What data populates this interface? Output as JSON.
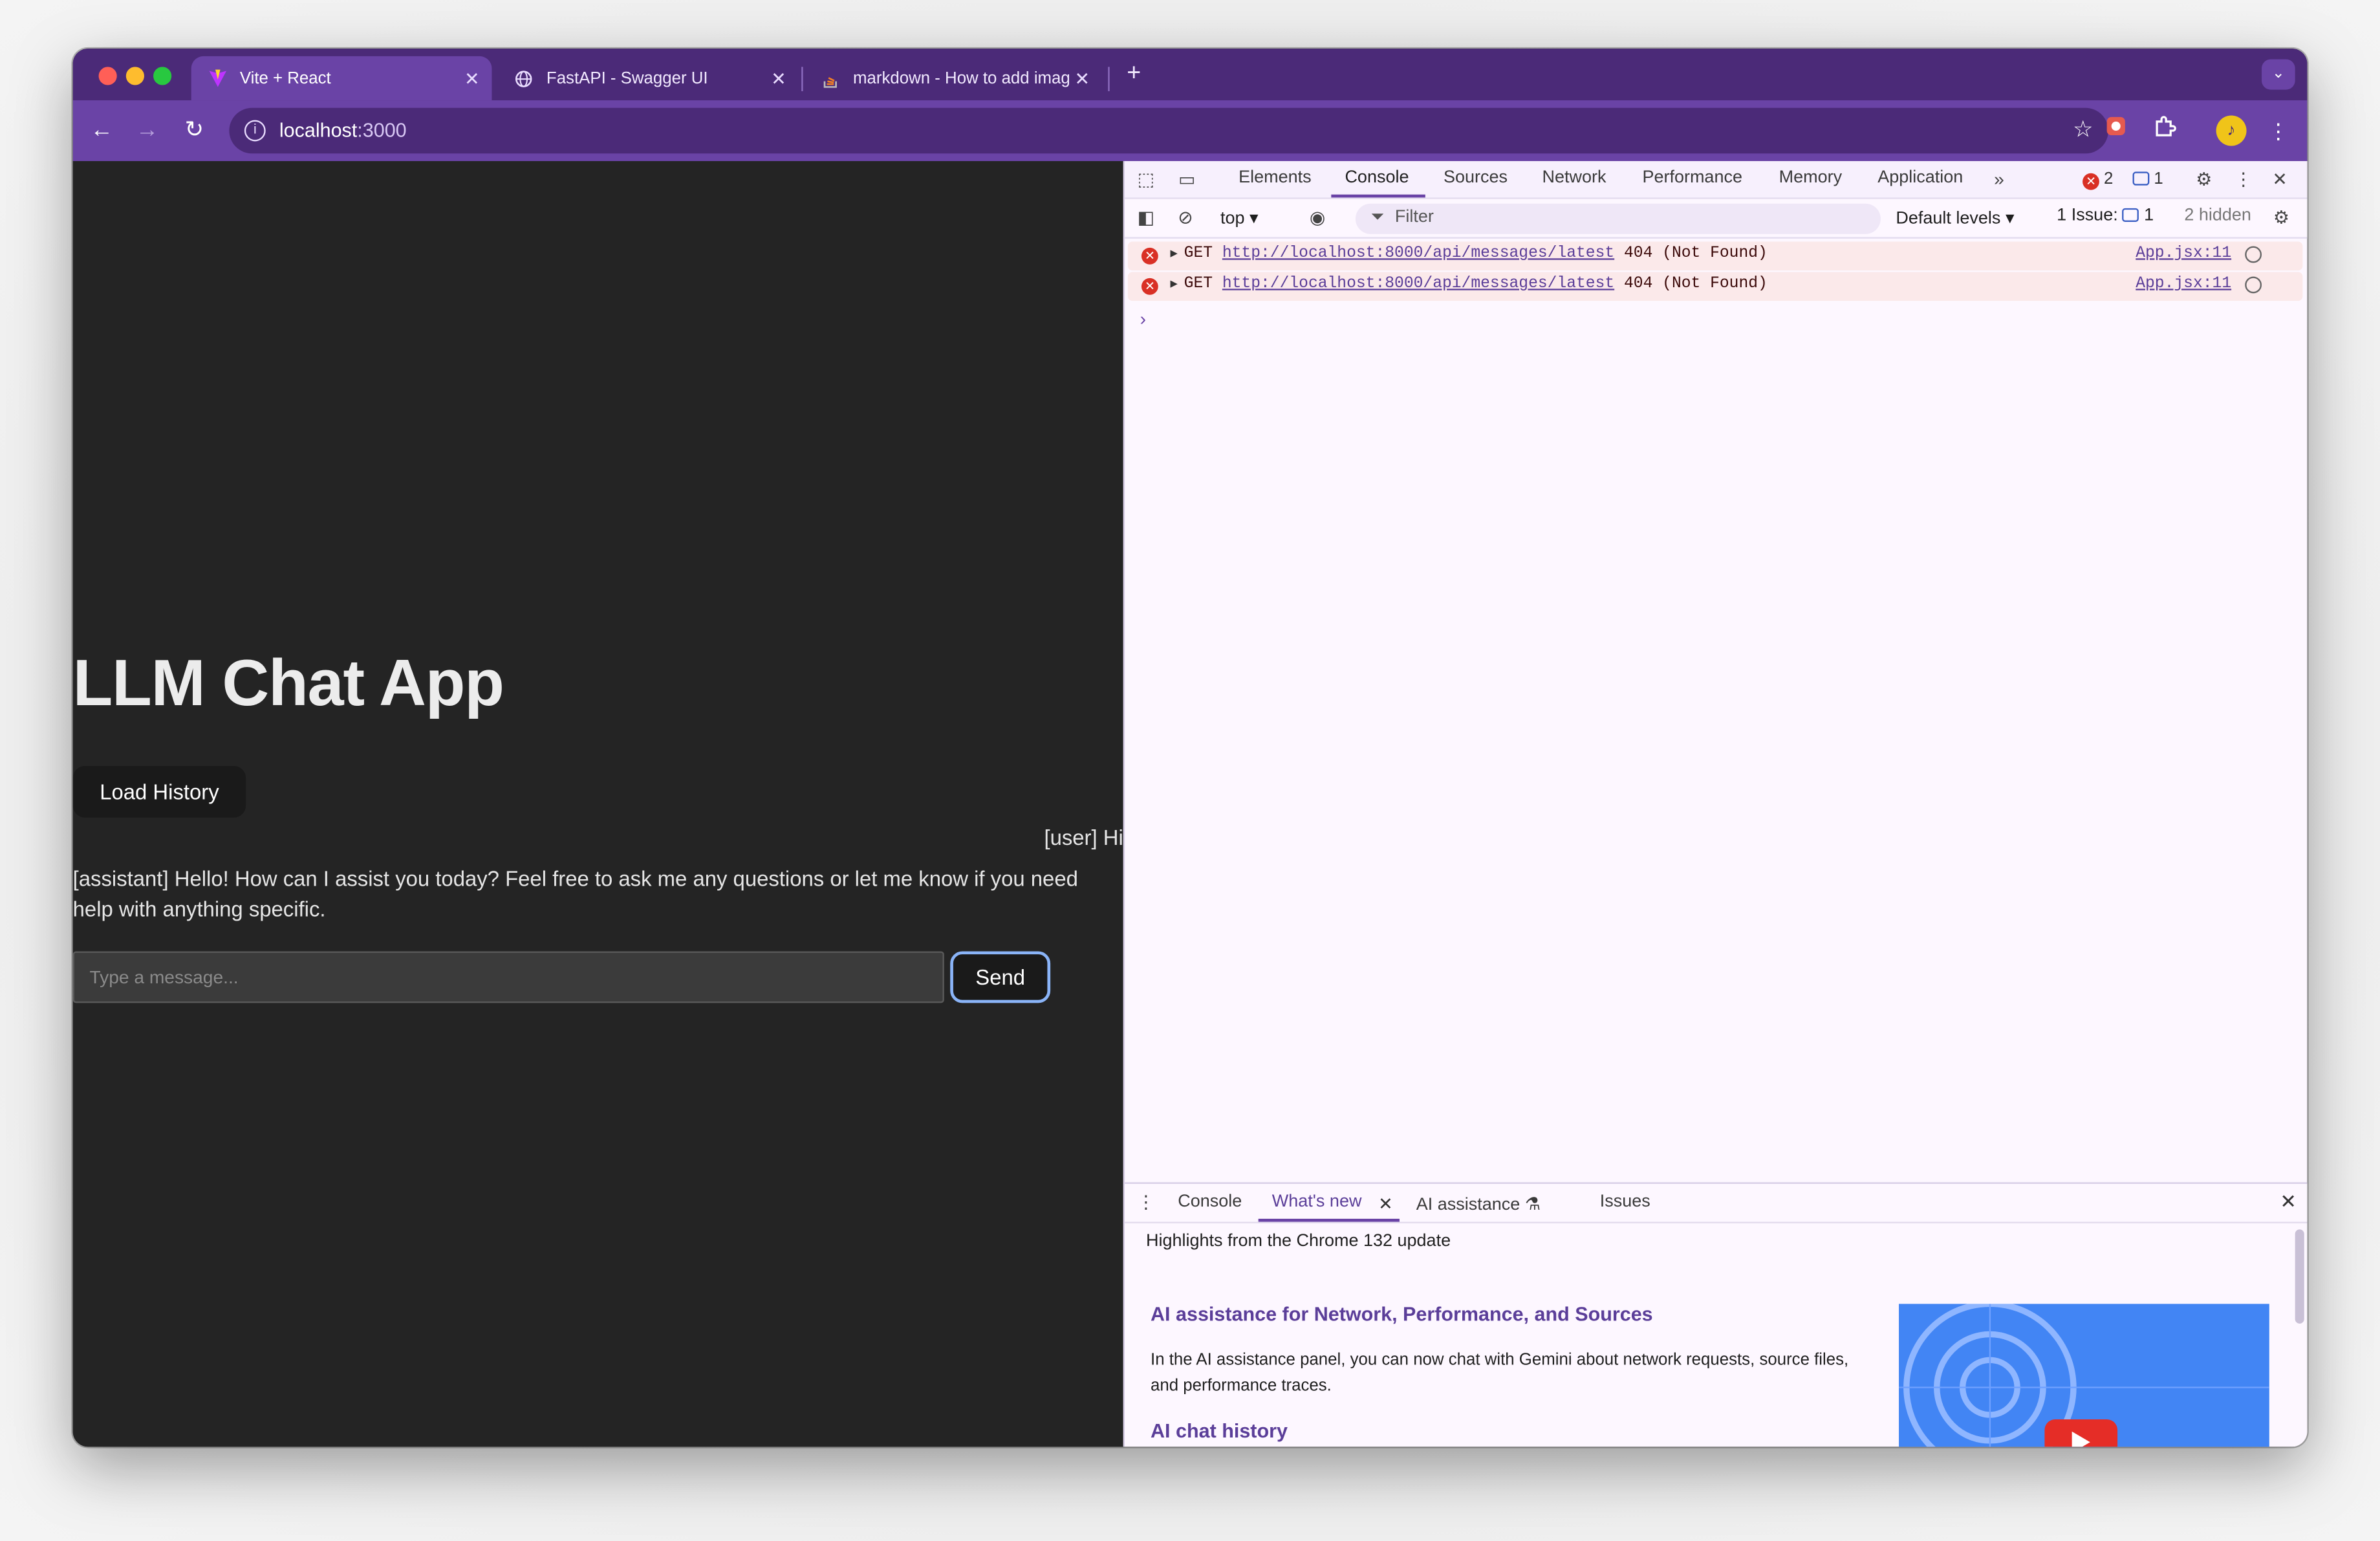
{
  "browser": {
    "tabs": [
      {
        "title": "Vite + React",
        "active": true,
        "icon": "vite-logo-icon"
      },
      {
        "title": "FastAPI - Swagger UI",
        "active": false,
        "icon": "globe-icon"
      },
      {
        "title": "markdown - How to add imag",
        "active": false,
        "icon": "stackoverflow-icon"
      }
    ],
    "url_host": "localhost",
    "url_port": ":3000",
    "colors": {
      "frame": "#4b2a78",
      "toolbar": "#6a43a6"
    }
  },
  "app": {
    "title": "LLM Chat App",
    "load_history_label": "Load History",
    "messages": {
      "user": "[user] Hi",
      "assistant": "[assistant] Hello! How can I assist you today? Feel free to ask me any questions or let me know if you need help with anything specific."
    },
    "input_placeholder": "Type a message...",
    "send_label": "Send"
  },
  "devtools": {
    "tabs": [
      "Elements",
      "Console",
      "Sources",
      "Network",
      "Performance",
      "Memory",
      "Application"
    ],
    "active_tab": "Console",
    "error_count": "2",
    "message_count": "1",
    "context": "top",
    "filter_placeholder": "Filter",
    "levels": "Default levels",
    "issues_label": "1 Issue:",
    "issues_count": "1",
    "hidden": "2 hidden",
    "console_rows": [
      {
        "method": "GET",
        "url": "http://localhost:8000/api/messages/latest",
        "status": "404 (Not Found)",
        "source": "App.jsx:11"
      },
      {
        "method": "GET",
        "url": "http://localhost:8000/api/messages/latest",
        "status": "404 (Not Found)",
        "source": "App.jsx:11"
      }
    ],
    "drawer": {
      "tabs": [
        "Console",
        "What's new",
        "AI assistance",
        "Issues"
      ],
      "active_tab": "What's new",
      "highlights": "Highlights from the Chrome 132 update",
      "section_title": "AI assistance for Network, Performance, and Sources",
      "section_text": "In the AI assistance panel, you can now chat with Gemini about network requests, source files, and performance traces.",
      "section_title_2": "AI chat history"
    }
  }
}
